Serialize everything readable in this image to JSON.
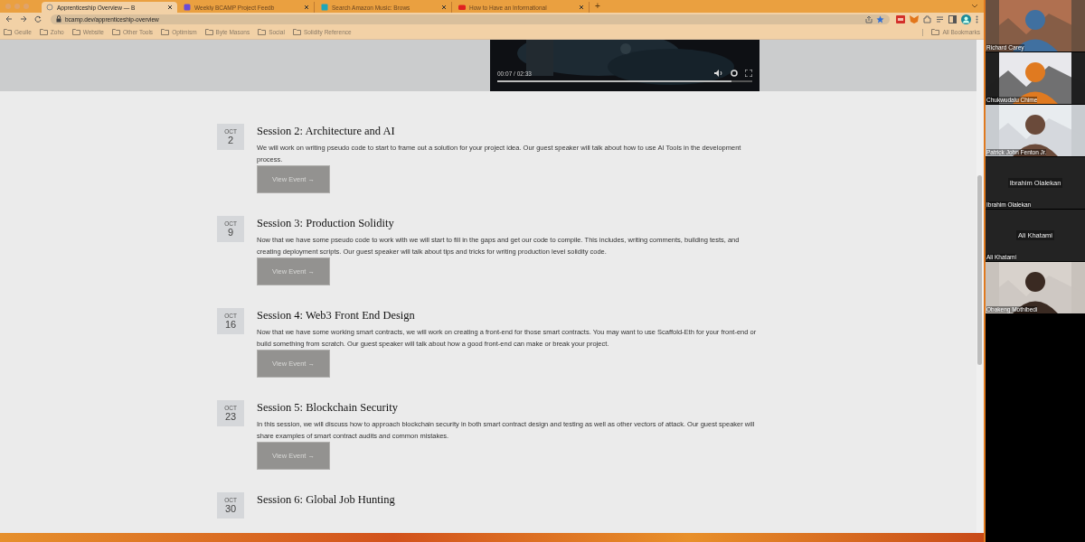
{
  "browser": {
    "tabs": [
      {
        "title": "Apprenticeship Overview — B",
        "selected": true
      },
      {
        "title": "Weekly BCAMP Project Feedb",
        "selected": false
      },
      {
        "title": "Search Amazon Music: Brows",
        "selected": false
      },
      {
        "title": "How to Have an Informational",
        "selected": false
      }
    ],
    "new_tab": "+",
    "url": "bcamp.dev/apprenticeship-overview",
    "bookmarks": [
      "Geulle",
      "Zoho",
      "Website",
      "Other Tools",
      "Optimism",
      "Byte Masons",
      "Social",
      "Solidity Reference"
    ],
    "all_bookmarks": "All Bookmarks"
  },
  "video": {
    "time": "00:07 / 02:33",
    "level": 0.92
  },
  "sessions": [
    {
      "month": "OCT",
      "day": "2",
      "title": "Session 2: Architecture and AI",
      "description": "We will work on writing pseudo code to start to frame out a solution for your project idea. Our guest speaker will talk about how to use AI Tools in the development process.",
      "button": "View Event →"
    },
    {
      "month": "OCT",
      "day": "9",
      "title": "Session 3: Production Solidity",
      "description": "Now that we have some pseudo code to work with we will start to fill in the gaps and get our code to compile.  This includes, writing comments, building tests, and creating deployment scripts.  Our guest speaker will talk about tips and tricks for writing production level solidity code.",
      "button": "View Event →"
    },
    {
      "month": "OCT",
      "day": "16",
      "title": "Session 4: Web3 Front End Design",
      "description": "Now that we have some working smart contracts, we will work on creating a front-end for those smart contracts.  You may want to use Scaffold-Eth for your front-end or build something from scratch.  Our guest speaker will talk about how a good front-end can make or break your project.",
      "button": "View Event →"
    },
    {
      "month": "OCT",
      "day": "23",
      "title": "Session 5: Blockchain Security",
      "description": "In this session, we will discuss how to approach blockchain security in both smart contract design and testing as well as other vectors of attack.  Our guest speaker will share examples of smart contract audits and common mistakes.",
      "button": "View Event →"
    },
    {
      "month": "OCT",
      "day": "30",
      "title": "Session 6: Global Job Hunting"
    }
  ],
  "meeting": {
    "participants": [
      {
        "name": "Richard Carey",
        "kind": "video"
      },
      {
        "name": "Chukwudalu Chime",
        "kind": "video"
      },
      {
        "name": "Patrick John Fenton Jr.",
        "kind": "video"
      },
      {
        "name": "Ibrahim Olalekan",
        "kind": "name-only",
        "big_name": "Ibrahim Olalekan"
      },
      {
        "name": "Ali Khatami",
        "kind": "name-only",
        "big_name": "Ali Khatami"
      },
      {
        "name": "Obakeng Mothibedi",
        "kind": "video"
      }
    ]
  }
}
